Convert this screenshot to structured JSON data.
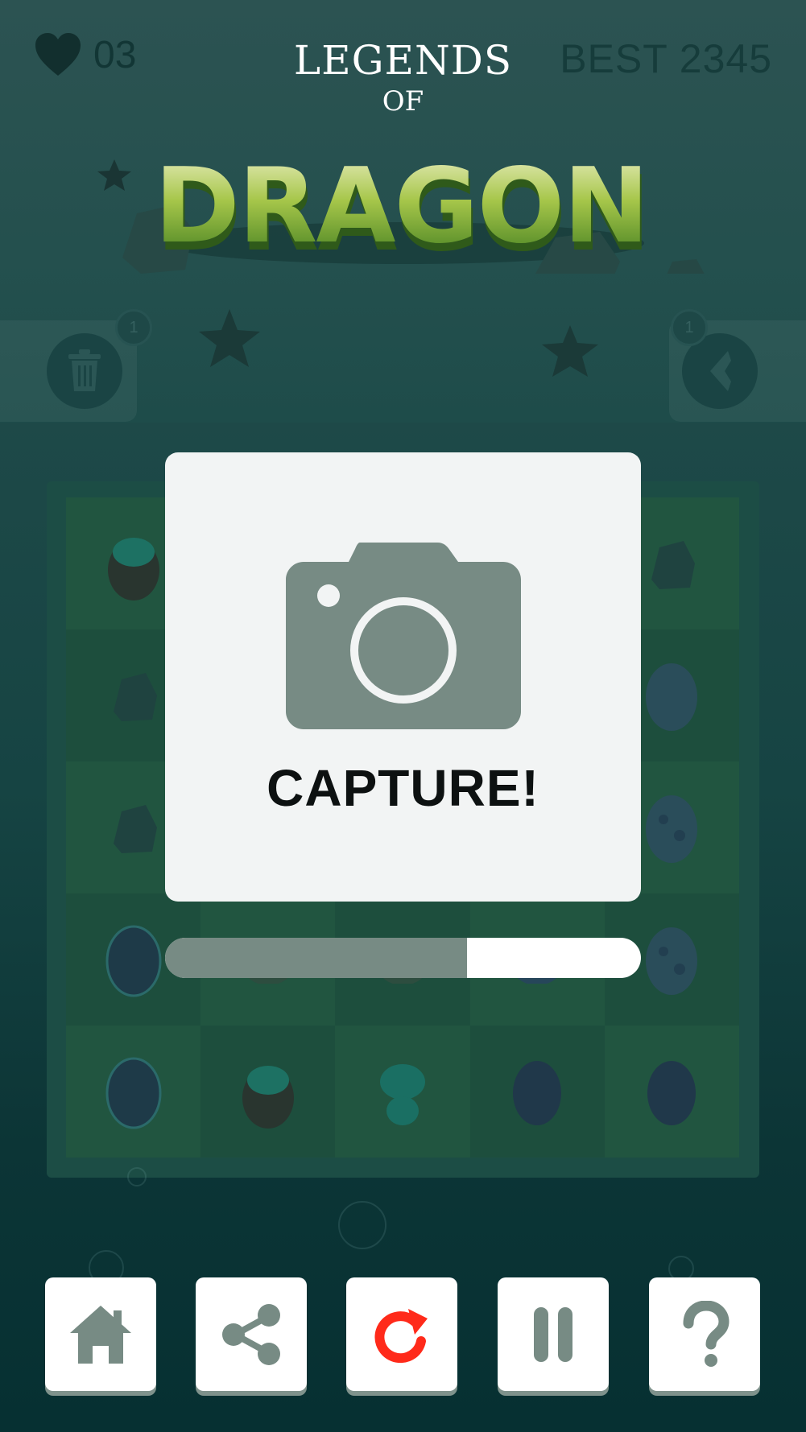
{
  "hud": {
    "lives": "03",
    "best": "BEST 2345"
  },
  "logo": {
    "line1": "LEGENDS",
    "line2": "OF",
    "line3": "DRAGON"
  },
  "side_buttons": {
    "trash_count": "1",
    "back_count": "1"
  },
  "modal": {
    "title": "CAPTURE!"
  },
  "progress": {
    "value": 0.635
  },
  "toolbar": {
    "items": [
      {
        "name": "home-button",
        "icon": "home-icon"
      },
      {
        "name": "share-button",
        "icon": "share-icon"
      },
      {
        "name": "restart-button",
        "icon": "restart-icon"
      },
      {
        "name": "pause-button",
        "icon": "pause-icon"
      },
      {
        "name": "help-button",
        "icon": "help-icon"
      }
    ]
  },
  "colors": {
    "icon_gray": "#778b84",
    "restart_red": "#ff2a1a",
    "modal_bg": "#f2f4f4"
  }
}
